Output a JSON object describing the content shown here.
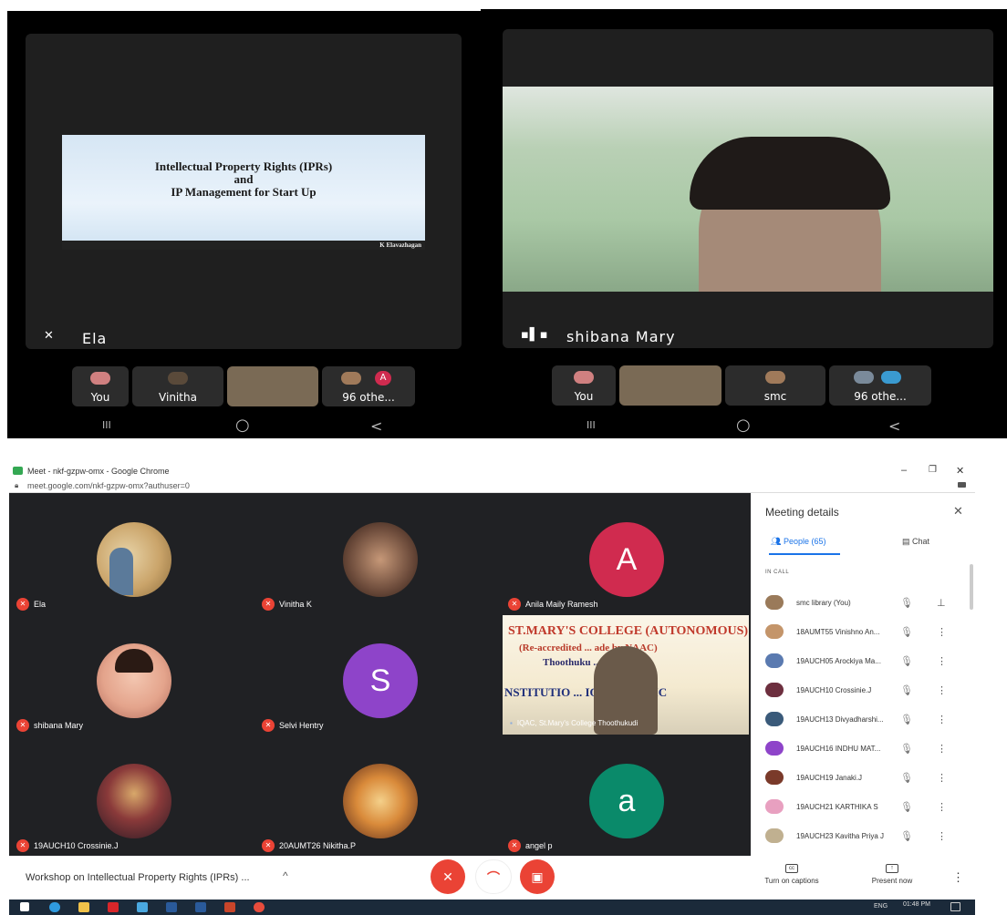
{
  "left_phone": {
    "slide": {
      "title_line1": "Intellectual Property Rights (IPRs)",
      "title_line2": "and",
      "title_line3": "IP Management for Start Up",
      "author": "K Elavazhagan"
    },
    "presenter_name": "Ela",
    "thumbnails": [
      "You",
      "Vinitha",
      "",
      "96 othe..."
    ],
    "avatar_letter": "A",
    "nav": {
      "recents": "III",
      "home": "○",
      "back": "<"
    }
  },
  "right_phone": {
    "speaker_name": "shibana Mary",
    "thumbnails": [
      "You",
      "",
      "smc",
      "96 othe..."
    ],
    "nav": {
      "recents": "III",
      "home": "○",
      "back": "<"
    }
  },
  "browser": {
    "window_title": "Meet - nkf-gzpw-omx - Google Chrome",
    "url": "meet.google.com/nkf-gzpw-omx?authuser=0",
    "tiles": [
      {
        "name": "Ela",
        "kind": "photo",
        "color": "#caa46a"
      },
      {
        "name": "Vinitha K",
        "kind": "photo",
        "color": "#6b4a3a"
      },
      {
        "name": "Anila Maily Ramesh",
        "kind": "letter",
        "letter": "A",
        "color": "#d02b4f"
      },
      {
        "name": "shibana Mary",
        "kind": "photo",
        "color": "#e4a48c"
      },
      {
        "name": "Selvi Hentry",
        "kind": "letter",
        "letter": "S",
        "color": "#8e44c9"
      },
      {
        "name": "IQAC, St.Mary's College Thoothukudi",
        "kind": "video"
      },
      {
        "name": "19AUCH10 Crossinie.J",
        "kind": "photo",
        "color": "#6d2f3f"
      },
      {
        "name": "20AUMT26 Nikitha.P",
        "kind": "photo",
        "color": "#d98a3a"
      },
      {
        "name": "angel p",
        "kind": "letter",
        "letter": "a",
        "color": "#0a8a6a"
      }
    ],
    "video_banner": {
      "line1": "ST.MARY'S COLLEGE (AUTONOMOUS)",
      "line2": "(Re-accredited ... ade by NAAC)",
      "line3": "Thoothuku ... amilnadu.",
      "line4": "NSTITUTIO ... ION CELL (IIC"
    },
    "panel": {
      "title": "Meeting details",
      "tab_people": "People (65)",
      "tab_chat": "Chat",
      "section": "IN CALL",
      "participants": [
        {
          "name": "smc library (You)",
          "color": "#9a7a5a"
        },
        {
          "name": "18AUMT55 Vinishno An...",
          "color": "#c4956a"
        },
        {
          "name": "19AUCH05 Arockiya Ma...",
          "color": "#5a7ab0"
        },
        {
          "name": "19AUCH10 Crossinie.J",
          "color": "#6d2f3f"
        },
        {
          "name": "19AUCH13 Divyadharshi...",
          "color": "#3a5a7a"
        },
        {
          "name": "19AUCH16 INDHU MAT...",
          "color": "#8e44c9"
        },
        {
          "name": "19AUCH19 Janaki.J",
          "color": "#7a3a2a"
        },
        {
          "name": "19AUCH21 KARTHIKA S",
          "color": "#e8a0c0"
        },
        {
          "name": "19AUCH23 Kavitha Priya J",
          "color": "#c0b090"
        }
      ],
      "captions_label": "Turn on captions",
      "present_label": "Present now"
    },
    "meeting_title": "Workshop on Intellectual Property Rights (IPRs) ...",
    "clock": {
      "time": "01:48 PM",
      "lang": "ENG"
    }
  }
}
